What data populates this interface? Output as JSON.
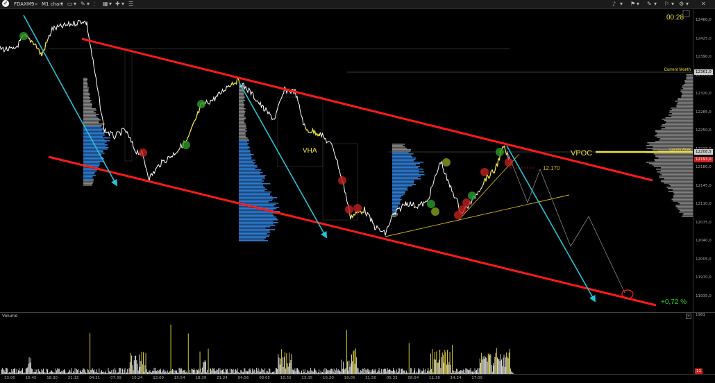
{
  "toolbar": {
    "symbol": "FDAXM9",
    "chart_type": "M1 chart",
    "left_icons": [
      "logo-icon",
      "search-icon",
      "dropdown-icon",
      "bar-chart-icon",
      "pencil-icon",
      "grid-icon",
      "plus-icon",
      "bars-icon"
    ],
    "right_icons": [
      "bell-icon",
      "brush-icon",
      "pin-icon",
      "flag-icon",
      "settings-icon",
      "close-icon"
    ]
  },
  "timer": "00:28",
  "price_axis": {
    "labels": [
      "12460,0",
      "12425,0",
      "12390,0",
      "12355,0",
      "12320,0",
      "12285,0",
      "12250,0",
      "12215,0",
      "12180,0",
      "12145,0",
      "12110,0",
      "12075,0",
      "12040,0",
      "12005,0",
      "11970,0",
      "11935,0"
    ],
    "tags": [
      {
        "text": "12361,0",
        "color": "#cccccc",
        "fg": "#000"
      },
      {
        "text": "12208,5",
        "color": "#cccccc",
        "fg": "#000"
      },
      {
        "text": "12193,0",
        "color": "#d02020",
        "fg": "#fff"
      }
    ]
  },
  "annotations": {
    "current_month": "Current Month",
    "current_week": "Current Week",
    "vpoc": "VPOC",
    "vha": "VHA",
    "target_level": "12.170",
    "percent": "+0,72 %"
  },
  "volume": {
    "title": "Volume",
    "axis_top": "1981",
    "axis_bottom": "11"
  },
  "time_axis": [
    "13:00",
    "15:45",
    "18:30",
    "21:15",
    "04:21",
    "07:39",
    "10:24",
    "13:09",
    "15:54",
    "18:39",
    "21:24",
    "04:56",
    "08:05",
    "10:50",
    "13:35",
    "16:20",
    "19:05",
    "21:50",
    "05:33",
    "08:54",
    "11:39",
    "14:24",
    "17:09"
  ],
  "colors": {
    "channel": "#ff1a1a",
    "arrow": "#27c4d9",
    "profile_blue": "#2f7fd8",
    "profile_gray": "#8c8c8c",
    "price_line": "#ffffff",
    "highlight": "#f2e33a",
    "vpoc": "#f2e33a",
    "percent": "#22dd22"
  }
}
